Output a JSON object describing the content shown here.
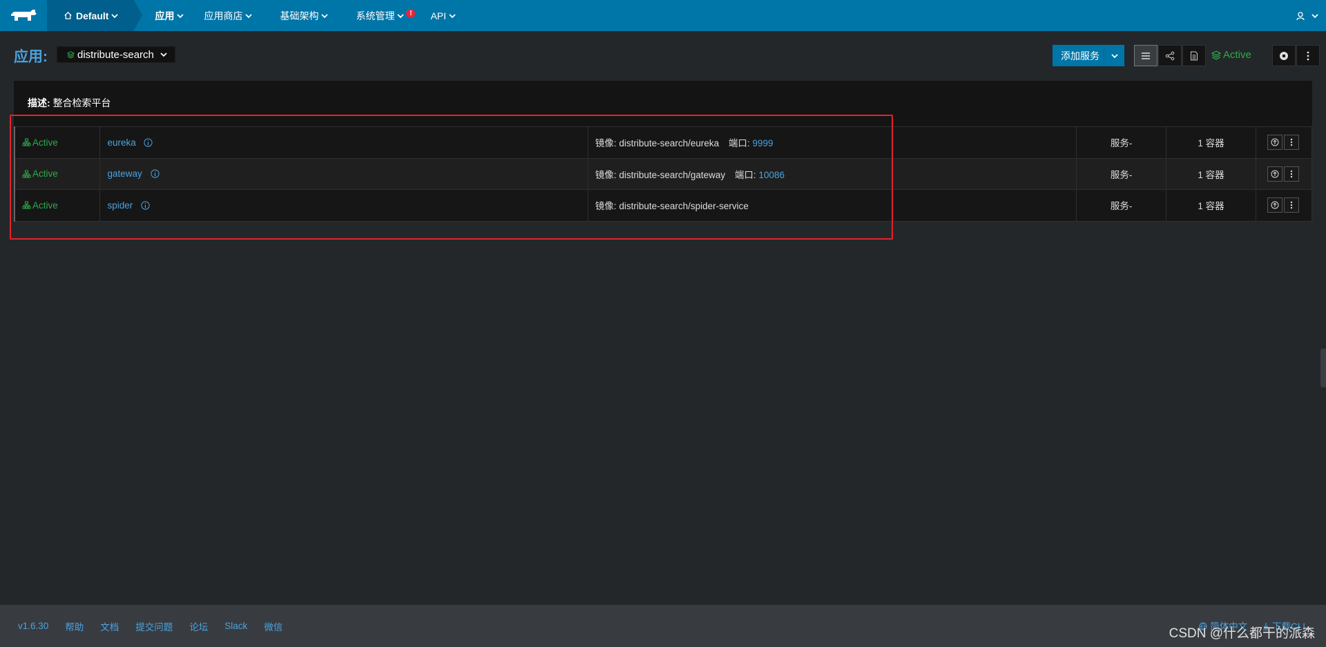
{
  "nav": {
    "env": "Default",
    "items": [
      {
        "label": "应用"
      },
      {
        "label": "应用商店"
      },
      {
        "label": "基础架构"
      },
      {
        "label": "系统管理"
      },
      {
        "label": "API"
      }
    ],
    "alert": "!"
  },
  "header": {
    "title": "应用:",
    "stack": "distribute-search",
    "add_service": "添加服务",
    "state": "Active"
  },
  "panel": {
    "desc_label": "描述:",
    "desc_value": "整合检索平台",
    "image_label": "镜像:",
    "port_label": "端口:",
    "services": [
      {
        "state": "Active",
        "name": "eureka",
        "image": "distribute-search/eureka",
        "port": "9999",
        "kind": "服务-",
        "containers": "1 容器"
      },
      {
        "state": "Active",
        "name": "gateway",
        "image": "distribute-search/gateway",
        "port": "10086",
        "kind": "服务-",
        "containers": "1 容器"
      },
      {
        "state": "Active",
        "name": "spider",
        "image": "distribute-search/spider-service",
        "port": "",
        "kind": "服务-",
        "containers": "1 容器"
      }
    ]
  },
  "footer": {
    "version": "v1.6.30",
    "links": [
      "帮助",
      "文档",
      "提交问题",
      "论坛",
      "Slack",
      "微信"
    ],
    "lang": "简体中文",
    "download": "下载CLI"
  },
  "watermark": "CSDN @什么都干的派森",
  "colors": {
    "nav": "#0075a8",
    "active": "#2da94c",
    "link": "#4aa3df",
    "highlight": "#e5222c"
  }
}
